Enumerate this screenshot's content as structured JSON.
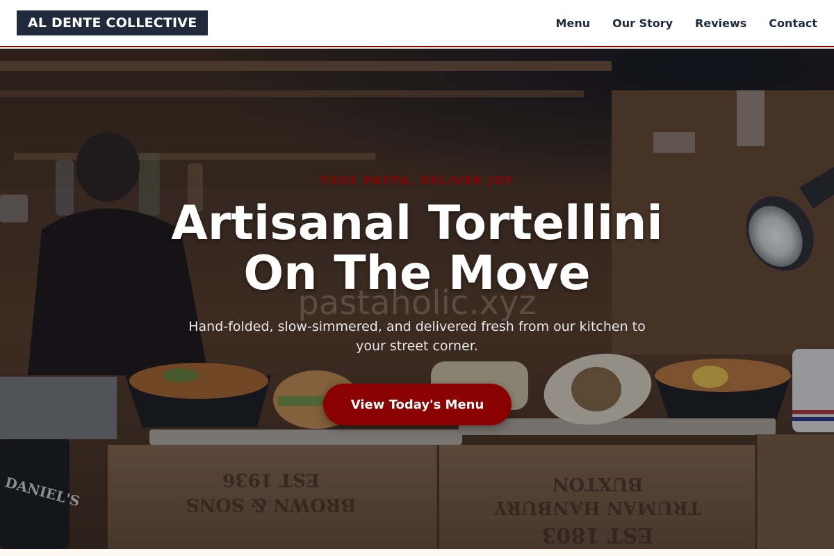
{
  "brand": {
    "logo_text": "AL DENTE COLLECTIVE"
  },
  "nav": {
    "items": [
      {
        "label": "Menu"
      },
      {
        "label": "Our Story"
      },
      {
        "label": "Reviews"
      },
      {
        "label": "Contact"
      }
    ]
  },
  "hero": {
    "tagline": "TOSS PASTA, DELIVER JOY",
    "headline_line1": "Artisanal Tortellini",
    "headline_line2": "On The Move",
    "watermark": "pastaholic.xyz",
    "subtitle": "Hand-folded, slow-simmered, and delivered fresh from our kitchen to your street corner.",
    "cta_label": "View Today's Menu",
    "background_crate_text_1": "EST 1936",
    "background_crate_text_2": "BROWN & SONS",
    "background_crate_text_3": "EST 1803",
    "background_crate_text_4": "TRUMAN HANBURY",
    "background_crate_text_5": "BUXTON",
    "background_bottle_label": "DANIEL'S"
  },
  "colors": {
    "accent": "#8b0000",
    "navy": "#1f2a3c",
    "header_bg": "#ffffff",
    "page_bg": "#fff8f0"
  }
}
